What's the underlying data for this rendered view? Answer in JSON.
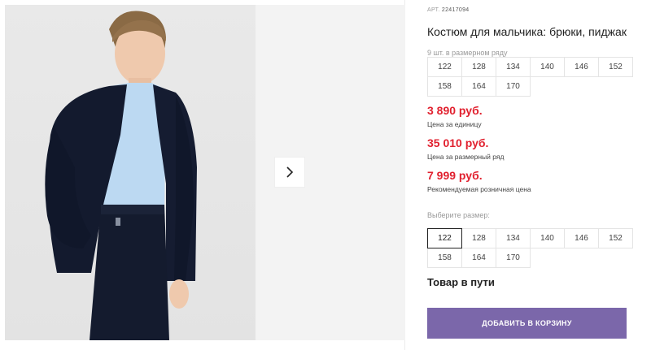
{
  "gallery": {
    "next_icon": "chevron-right-icon"
  },
  "product": {
    "article_label": "АРТ.",
    "article_number": "22417094",
    "title": "Костюм для мальчика: брюки, пиджак",
    "pack_note": "9 шт. в размерном ряду",
    "pack_sizes": [
      "122",
      "128",
      "134",
      "140",
      "146",
      "152",
      "158",
      "164",
      "170"
    ]
  },
  "prices": [
    {
      "value": "3 890 руб.",
      "label": "Цена за единицу"
    },
    {
      "value": "35 010 руб.",
      "label": "Цена за размерный ряд"
    },
    {
      "value": "7 999 руб.",
      "label": "Рекомендуемая розничная цена"
    }
  ],
  "size_picker": {
    "label": "Выберите размер:",
    "sizes": [
      "122",
      "128",
      "134",
      "140",
      "146",
      "152",
      "158",
      "164",
      "170"
    ],
    "selected": "122"
  },
  "availability": "Товар в пути",
  "add_to_cart_label": "ДОБАВИТЬ В КОРЗИНУ",
  "colors": {
    "price": "#e1212f",
    "button": "#7b67aa"
  }
}
